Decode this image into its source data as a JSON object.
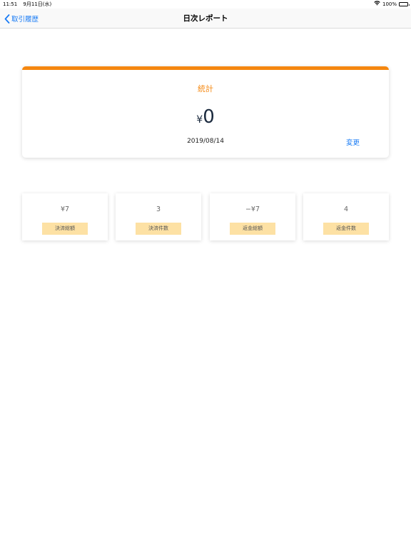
{
  "status_bar": {
    "time": "11:51",
    "date": "9月11日(水)",
    "battery": "100%"
  },
  "nav": {
    "back_label": "取引履歴",
    "title": "日次レポート"
  },
  "summary": {
    "title": "統計",
    "currency": "¥",
    "amount": "0",
    "date": "2019/08/14",
    "change_label": "変更"
  },
  "stats": [
    {
      "value": "¥7",
      "label": "決済総額"
    },
    {
      "value": "3",
      "label": "決済件数"
    },
    {
      "value": "−¥7",
      "label": "返金総額"
    },
    {
      "value": "4",
      "label": "返金件数"
    }
  ],
  "colors": {
    "accent": "#f5870f",
    "link": "#1a7cf5",
    "badge": "#fde1a4"
  }
}
